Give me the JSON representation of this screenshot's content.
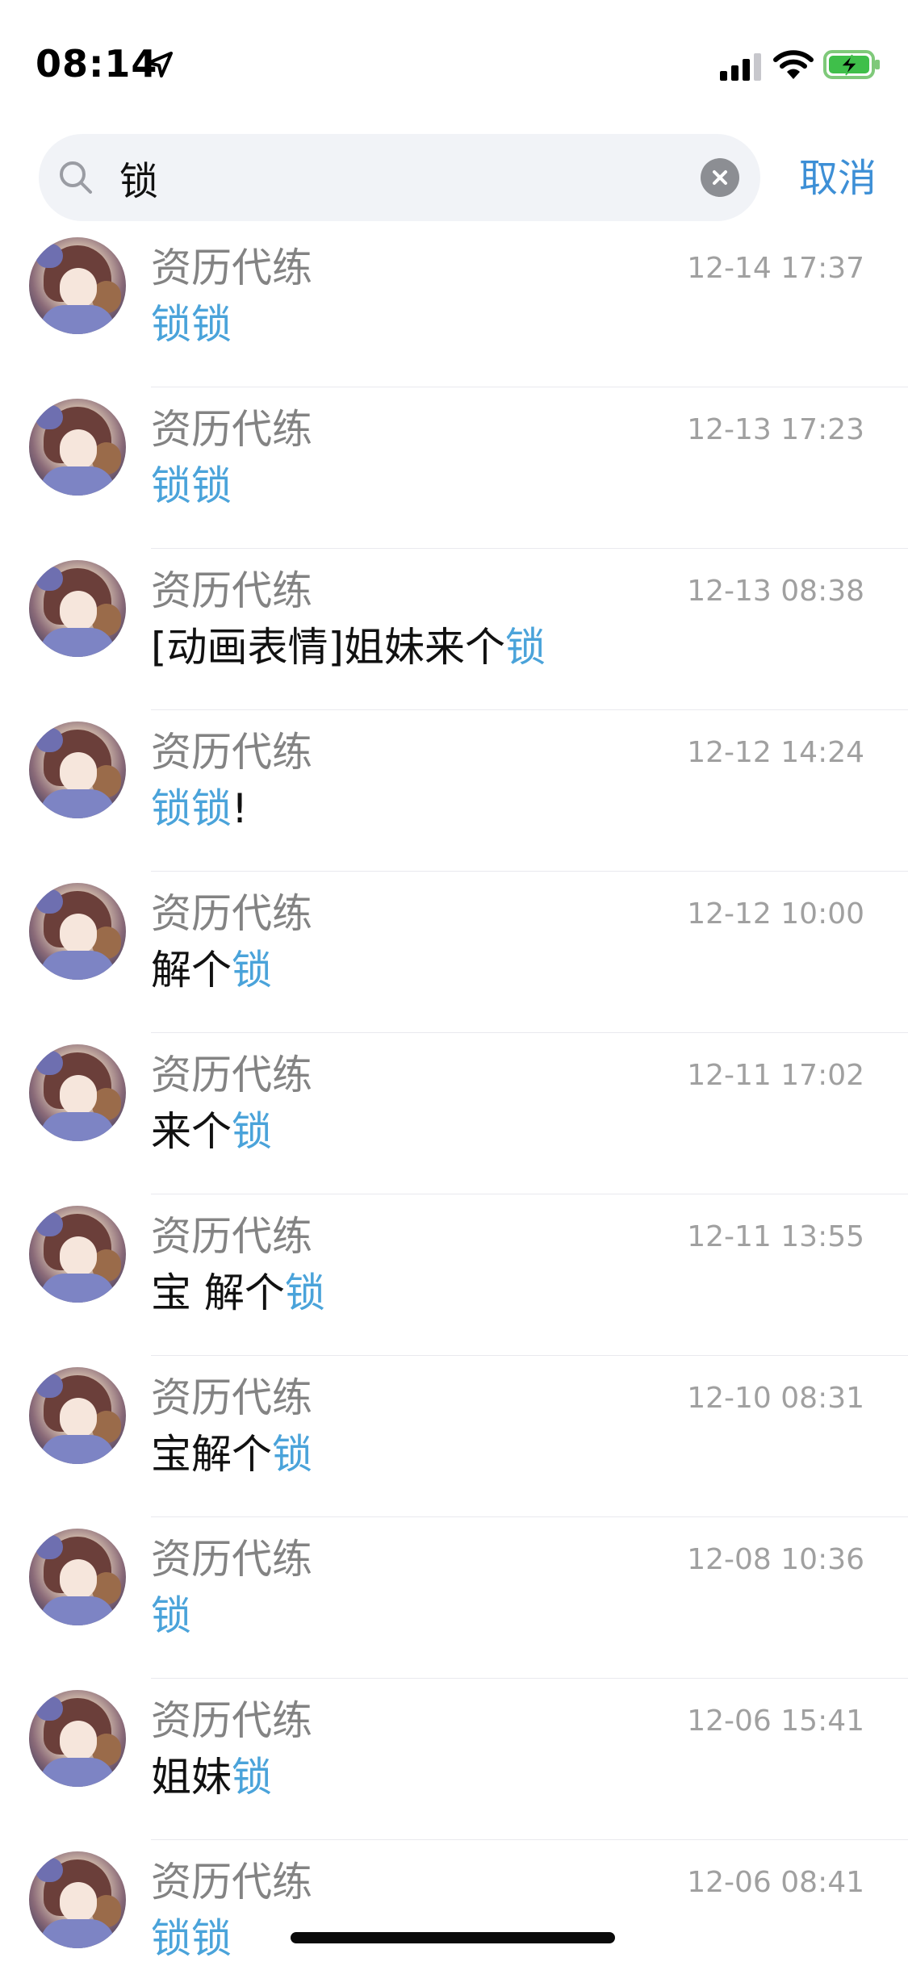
{
  "status_bar": {
    "time": "08:14"
  },
  "search": {
    "query": "锁",
    "cancel_label": "取消"
  },
  "results": [
    {
      "name": "资历代练",
      "time": "12-14 17:37",
      "parts": [
        {
          "text": "锁锁",
          "hl": true
        }
      ]
    },
    {
      "name": "资历代练",
      "time": "12-13 17:23",
      "parts": [
        {
          "text": "锁锁",
          "hl": true
        }
      ]
    },
    {
      "name": "资历代练",
      "time": "12-13 08:38",
      "parts": [
        {
          "text": "[动画表情]姐妹来个",
          "hl": false
        },
        {
          "text": "锁",
          "hl": true
        }
      ]
    },
    {
      "name": "资历代练",
      "time": "12-12 14:24",
      "parts": [
        {
          "text": "锁锁",
          "hl": true
        },
        {
          "text": "!",
          "hl": false
        }
      ]
    },
    {
      "name": "资历代练",
      "time": "12-12 10:00",
      "parts": [
        {
          "text": "解个",
          "hl": false
        },
        {
          "text": "锁",
          "hl": true
        }
      ]
    },
    {
      "name": "资历代练",
      "time": "12-11 17:02",
      "parts": [
        {
          "text": "来个",
          "hl": false
        },
        {
          "text": "锁",
          "hl": true
        }
      ]
    },
    {
      "name": "资历代练",
      "time": "12-11 13:55",
      "parts": [
        {
          "text": "宝 解个",
          "hl": false
        },
        {
          "text": "锁",
          "hl": true
        }
      ]
    },
    {
      "name": "资历代练",
      "time": "12-10 08:31",
      "parts": [
        {
          "text": "宝解个",
          "hl": false
        },
        {
          "text": "锁",
          "hl": true
        }
      ]
    },
    {
      "name": "资历代练",
      "time": "12-08 10:36",
      "parts": [
        {
          "text": "锁",
          "hl": true
        }
      ]
    },
    {
      "name": "资历代练",
      "time": "12-06 15:41",
      "parts": [
        {
          "text": "姐妹",
          "hl": false
        },
        {
          "text": "锁",
          "hl": true
        }
      ]
    },
    {
      "name": "资历代练",
      "time": "12-06 08:41",
      "parts": [
        {
          "text": "锁锁",
          "hl": true
        }
      ]
    }
  ],
  "colors": {
    "highlight": "#4aa3da",
    "cancel": "#3d8fd6",
    "name": "#838383",
    "time": "#a0a0a0"
  },
  "icons": {
    "location": "location-arrow-icon",
    "signal": "cellular-signal-icon",
    "wifi": "wifi-icon",
    "battery": "battery-charging-icon",
    "search": "search-icon",
    "clear": "clear-icon"
  }
}
